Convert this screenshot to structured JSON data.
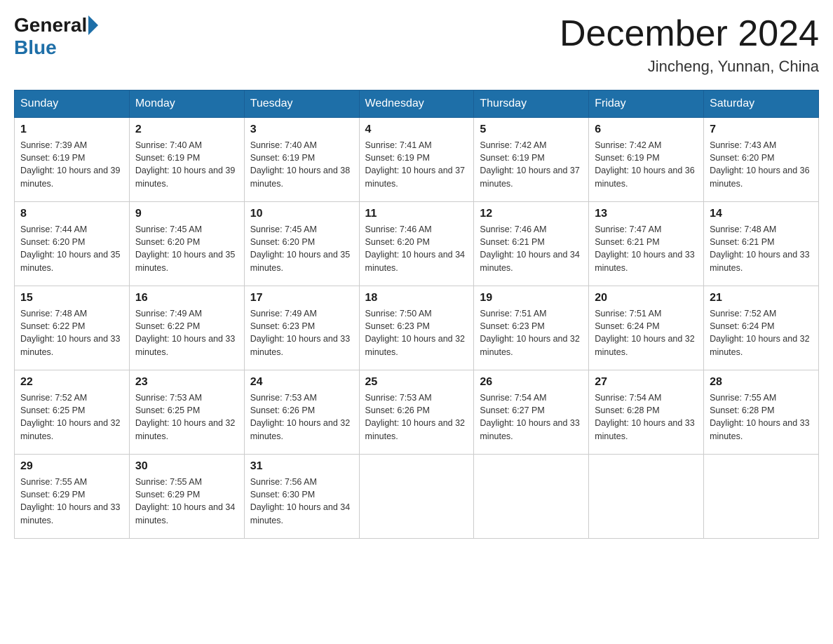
{
  "header": {
    "logo_general": "General",
    "logo_blue": "Blue",
    "month_title": "December 2024",
    "location": "Jincheng, Yunnan, China"
  },
  "days_of_week": [
    "Sunday",
    "Monday",
    "Tuesday",
    "Wednesday",
    "Thursday",
    "Friday",
    "Saturday"
  ],
  "weeks": [
    [
      {
        "num": "1",
        "sunrise": "7:39 AM",
        "sunset": "6:19 PM",
        "daylight": "10 hours and 39 minutes."
      },
      {
        "num": "2",
        "sunrise": "7:40 AM",
        "sunset": "6:19 PM",
        "daylight": "10 hours and 39 minutes."
      },
      {
        "num": "3",
        "sunrise": "7:40 AM",
        "sunset": "6:19 PM",
        "daylight": "10 hours and 38 minutes."
      },
      {
        "num": "4",
        "sunrise": "7:41 AM",
        "sunset": "6:19 PM",
        "daylight": "10 hours and 37 minutes."
      },
      {
        "num": "5",
        "sunrise": "7:42 AM",
        "sunset": "6:19 PM",
        "daylight": "10 hours and 37 minutes."
      },
      {
        "num": "6",
        "sunrise": "7:42 AM",
        "sunset": "6:19 PM",
        "daylight": "10 hours and 36 minutes."
      },
      {
        "num": "7",
        "sunrise": "7:43 AM",
        "sunset": "6:20 PM",
        "daylight": "10 hours and 36 minutes."
      }
    ],
    [
      {
        "num": "8",
        "sunrise": "7:44 AM",
        "sunset": "6:20 PM",
        "daylight": "10 hours and 35 minutes."
      },
      {
        "num": "9",
        "sunrise": "7:45 AM",
        "sunset": "6:20 PM",
        "daylight": "10 hours and 35 minutes."
      },
      {
        "num": "10",
        "sunrise": "7:45 AM",
        "sunset": "6:20 PM",
        "daylight": "10 hours and 35 minutes."
      },
      {
        "num": "11",
        "sunrise": "7:46 AM",
        "sunset": "6:20 PM",
        "daylight": "10 hours and 34 minutes."
      },
      {
        "num": "12",
        "sunrise": "7:46 AM",
        "sunset": "6:21 PM",
        "daylight": "10 hours and 34 minutes."
      },
      {
        "num": "13",
        "sunrise": "7:47 AM",
        "sunset": "6:21 PM",
        "daylight": "10 hours and 33 minutes."
      },
      {
        "num": "14",
        "sunrise": "7:48 AM",
        "sunset": "6:21 PM",
        "daylight": "10 hours and 33 minutes."
      }
    ],
    [
      {
        "num": "15",
        "sunrise": "7:48 AM",
        "sunset": "6:22 PM",
        "daylight": "10 hours and 33 minutes."
      },
      {
        "num": "16",
        "sunrise": "7:49 AM",
        "sunset": "6:22 PM",
        "daylight": "10 hours and 33 minutes."
      },
      {
        "num": "17",
        "sunrise": "7:49 AM",
        "sunset": "6:23 PM",
        "daylight": "10 hours and 33 minutes."
      },
      {
        "num": "18",
        "sunrise": "7:50 AM",
        "sunset": "6:23 PM",
        "daylight": "10 hours and 32 minutes."
      },
      {
        "num": "19",
        "sunrise": "7:51 AM",
        "sunset": "6:23 PM",
        "daylight": "10 hours and 32 minutes."
      },
      {
        "num": "20",
        "sunrise": "7:51 AM",
        "sunset": "6:24 PM",
        "daylight": "10 hours and 32 minutes."
      },
      {
        "num": "21",
        "sunrise": "7:52 AM",
        "sunset": "6:24 PM",
        "daylight": "10 hours and 32 minutes."
      }
    ],
    [
      {
        "num": "22",
        "sunrise": "7:52 AM",
        "sunset": "6:25 PM",
        "daylight": "10 hours and 32 minutes."
      },
      {
        "num": "23",
        "sunrise": "7:53 AM",
        "sunset": "6:25 PM",
        "daylight": "10 hours and 32 minutes."
      },
      {
        "num": "24",
        "sunrise": "7:53 AM",
        "sunset": "6:26 PM",
        "daylight": "10 hours and 32 minutes."
      },
      {
        "num": "25",
        "sunrise": "7:53 AM",
        "sunset": "6:26 PM",
        "daylight": "10 hours and 32 minutes."
      },
      {
        "num": "26",
        "sunrise": "7:54 AM",
        "sunset": "6:27 PM",
        "daylight": "10 hours and 33 minutes."
      },
      {
        "num": "27",
        "sunrise": "7:54 AM",
        "sunset": "6:28 PM",
        "daylight": "10 hours and 33 minutes."
      },
      {
        "num": "28",
        "sunrise": "7:55 AM",
        "sunset": "6:28 PM",
        "daylight": "10 hours and 33 minutes."
      }
    ],
    [
      {
        "num": "29",
        "sunrise": "7:55 AM",
        "sunset": "6:29 PM",
        "daylight": "10 hours and 33 minutes."
      },
      {
        "num": "30",
        "sunrise": "7:55 AM",
        "sunset": "6:29 PM",
        "daylight": "10 hours and 34 minutes."
      },
      {
        "num": "31",
        "sunrise": "7:56 AM",
        "sunset": "6:30 PM",
        "daylight": "10 hours and 34 minutes."
      },
      null,
      null,
      null,
      null
    ]
  ]
}
